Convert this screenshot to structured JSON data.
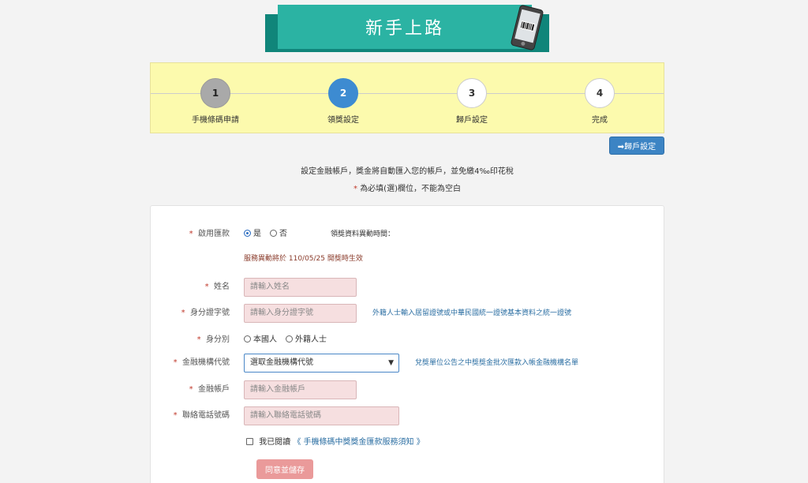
{
  "banner": {
    "title": "新手上路"
  },
  "steps": [
    {
      "num": "1",
      "label": "手機條碼申請"
    },
    {
      "num": "2",
      "label": "領獎設定"
    },
    {
      "num": "3",
      "label": "歸戶設定"
    },
    {
      "num": "4",
      "label": "完成"
    }
  ],
  "top_button": {
    "label": "➡歸戶設定"
  },
  "intro": {
    "line1": "設定金融帳戶，獎金將自動匯入您的帳戶，並免繳4‰印花稅",
    "required_mark": "*",
    "line2": "為必填(選)欄位，不能為空白"
  },
  "form": {
    "required_mark": "*",
    "enable": {
      "label": "啟用匯款",
      "yes": "是",
      "no": "否",
      "changed_time_label": "領獎資料異動時間："
    },
    "notice": "服務異動將於 110/05/25 開獎時生效",
    "name": {
      "label": "姓名",
      "placeholder": "請輸入姓名"
    },
    "id_number": {
      "label": "身分證字號",
      "placeholder": "請輸入身分證字號",
      "hint": "外籍人士輸入居留證號或中華民國統一證號基本資料之統一證號"
    },
    "identity": {
      "label": "身分別",
      "native": "本國人",
      "foreign": "外籍人士"
    },
    "bank_code": {
      "label": "金融機構代號",
      "selected": "選取金融機構代號",
      "hint": "兌獎單位公告之中獎獎金批次匯款入帳金融機構名單"
    },
    "account": {
      "label": "金融帳戶",
      "placeholder": "請輸入金融帳戶"
    },
    "phone": {
      "label": "聯絡電話號碼",
      "placeholder": "請輸入聯絡電話號碼"
    },
    "agree": {
      "text": "我已閱讀",
      "link": "《 手機條碼中獎獎金匯款服務須知 》"
    },
    "save_button": "同意並儲存"
  },
  "colors": {
    "banner": "#2bb3a3",
    "banner_dark": "#10857a",
    "steps_bg": "#fcfaad",
    "active_step": "#3d8bd1",
    "input_bg": "#f6dfe0",
    "save_button": "#ea9a9a"
  }
}
